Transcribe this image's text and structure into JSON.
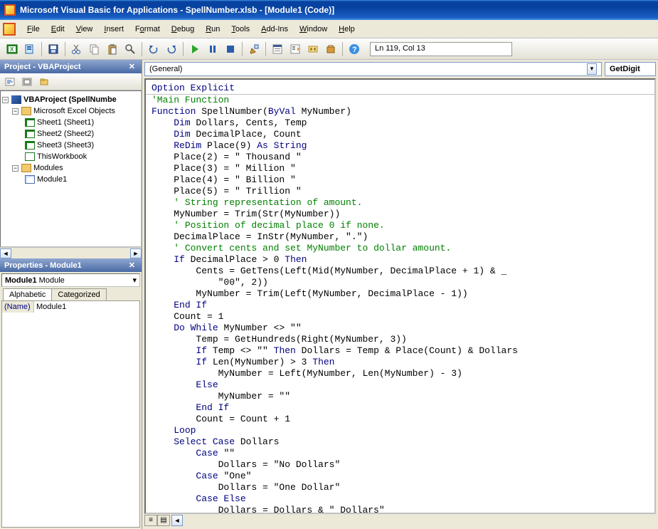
{
  "window": {
    "title": "Microsoft Visual Basic for Applications - SpellNumber.xlsb - [Module1 (Code)]"
  },
  "menu": {
    "file": "File",
    "edit": "Edit",
    "view": "View",
    "insert": "Insert",
    "format": "Format",
    "debug": "Debug",
    "run": "Run",
    "tools": "Tools",
    "addins": "Add-Ins",
    "window": "Window",
    "help": "Help"
  },
  "toolbar": {
    "cursor_position": "Ln 119, Col 13"
  },
  "project_panel": {
    "title": "Project - VBAProject",
    "root": "VBAProject (SpellNumbe",
    "excel_objects": "Microsoft Excel Objects",
    "sheets": [
      "Sheet1 (Sheet1)",
      "Sheet2 (Sheet2)",
      "Sheet3 (Sheet3)"
    ],
    "thisworkbook": "ThisWorkbook",
    "modules_folder": "Modules",
    "module1": "Module1"
  },
  "properties_panel": {
    "title": "Properties - Module1",
    "object_name": "Module1",
    "object_type": " Module",
    "tab_alphabetic": "Alphabetic",
    "tab_categorized": "Categorized",
    "prop_name_label": "(Name)",
    "prop_name_value": "Module1"
  },
  "code_dropdowns": {
    "left": "(General)",
    "right": "GetDigit"
  },
  "code": {
    "l01": {
      "a": "Option Explicit"
    },
    "l02": {
      "a": "'Main Function"
    },
    "l03": {
      "a": "Function",
      "b": " SpellNumber(",
      "c": "ByVal",
      "d": " MyNumber)"
    },
    "l04": {
      "a": "    ",
      "b": "Dim",
      "c": " Dollars, Cents, Temp"
    },
    "l05": {
      "a": "    ",
      "b": "Dim",
      "c": " DecimalPlace, Count"
    },
    "l06": {
      "a": "    ",
      "b": "ReDim",
      "c": " Place(9) ",
      "d": "As String"
    },
    "l07": {
      "a": "    Place(2) = \" Thousand \""
    },
    "l08": {
      "a": "    Place(3) = \" Million \""
    },
    "l09": {
      "a": "    Place(4) = \" Billion \""
    },
    "l10": {
      "a": "    Place(5) = \" Trillion \""
    },
    "l11": {
      "a": "    ",
      "b": "' String representation of amount."
    },
    "l12": {
      "a": "    MyNumber = Trim(Str(MyNumber))"
    },
    "l13": {
      "a": "    ",
      "b": "' Position of decimal place 0 if none."
    },
    "l14": {
      "a": "    DecimalPlace = InStr(MyNumber, \".\")"
    },
    "l15": {
      "a": "    ",
      "b": "' Convert cents and set MyNumber to dollar amount."
    },
    "l16": {
      "a": "    ",
      "b": "If",
      "c": " DecimalPlace > 0 ",
      "d": "Then"
    },
    "l17": {
      "a": "        Cents = GetTens(Left(Mid(MyNumber, DecimalPlace + 1) & _"
    },
    "l18": {
      "a": "            \"00\", 2))"
    },
    "l19": {
      "a": "        MyNumber = Trim(Left(MyNumber, DecimalPlace - 1))"
    },
    "l20": {
      "a": "    ",
      "b": "End If"
    },
    "l21": {
      "a": "    Count = 1"
    },
    "l22": {
      "a": "    ",
      "b": "Do While",
      "c": " MyNumber <> \"\""
    },
    "l23": {
      "a": "        Temp = GetHundreds(Right(MyNumber, 3))"
    },
    "l24": {
      "a": "        ",
      "b": "If",
      "c": " Temp <> \"\" ",
      "d": "Then",
      "e": " Dollars = Temp & Place(Count) & Dollars"
    },
    "l25": {
      "a": "        ",
      "b": "If",
      "c": " Len(MyNumber) > 3 ",
      "d": "Then"
    },
    "l26": {
      "a": "            MyNumber = Left(MyNumber, Len(MyNumber) - 3)"
    },
    "l27": {
      "a": "        ",
      "b": "Else"
    },
    "l28": {
      "a": "            MyNumber = \"\""
    },
    "l29": {
      "a": "        ",
      "b": "End If"
    },
    "l30": {
      "a": "        Count = Count + 1"
    },
    "l31": {
      "a": "    ",
      "b": "Loop"
    },
    "l32": {
      "a": "    ",
      "b": "Select Case",
      "c": " Dollars"
    },
    "l33": {
      "a": "        ",
      "b": "Case",
      "c": " \"\""
    },
    "l34": {
      "a": "            Dollars = \"No Dollars\""
    },
    "l35": {
      "a": "        ",
      "b": "Case",
      "c": " \"One\""
    },
    "l36": {
      "a": "            Dollars = \"One Dollar\""
    },
    "l37": {
      "a": "        ",
      "b": "Case Else"
    },
    "l38": {
      "a": "            Dollars = Dollars & \" Dollars\""
    }
  }
}
